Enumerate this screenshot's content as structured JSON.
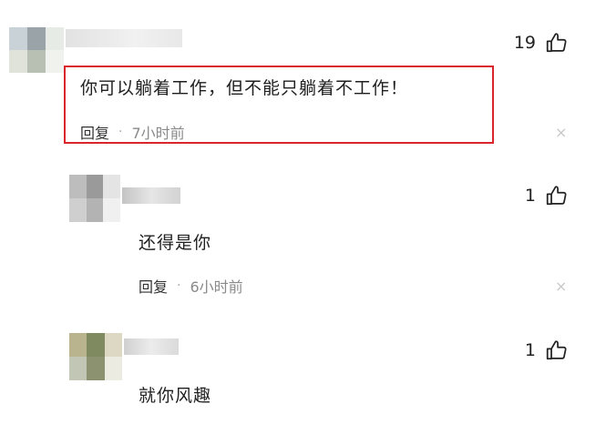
{
  "colors": {
    "highlight": "#d9252b",
    "text": "#1f1f1f",
    "meta": "#8a8a8a",
    "mosaic_c1": [
      "#9aa3a8",
      "#c9cfc4",
      "#dfe3da",
      "#b7c0b2"
    ],
    "mosaic_c2": [
      "#9a9a9a",
      "#c8c8c8",
      "#e4e4e4",
      "#b3b3b3"
    ],
    "mosaic_c3": [
      "#7f8a60",
      "#b9b48d",
      "#dcd8c4",
      "#c2c6b4"
    ]
  },
  "comments": [
    {
      "text": "你可以躺着工作，但不能只躺着不工作！",
      "reply_label": "回复",
      "separator": "·",
      "time": "7小时前",
      "likes": "19",
      "like_icon": "thumbs-up-icon",
      "close_icon": "×"
    },
    {
      "text": "还得是你",
      "reply_label": "回复",
      "separator": "·",
      "time": "6小时前",
      "likes": "1",
      "like_icon": "thumbs-up-icon",
      "close_icon": "×"
    },
    {
      "text": "就你风趣",
      "likes": "1",
      "like_icon": "thumbs-up-icon"
    }
  ]
}
